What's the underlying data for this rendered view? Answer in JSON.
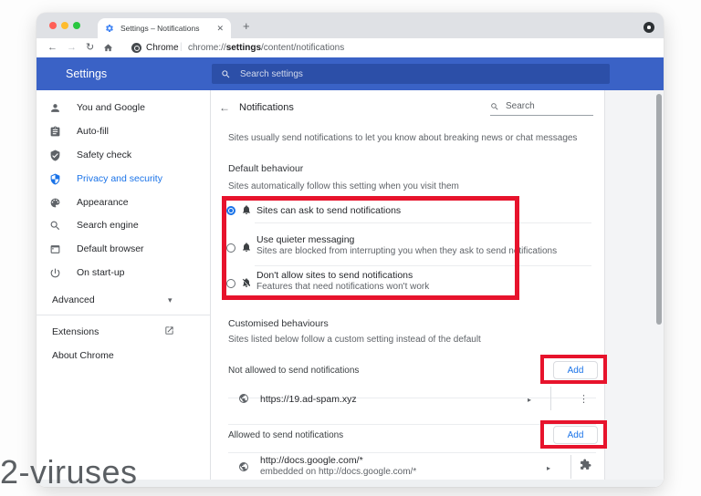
{
  "watermark": "2-viruses",
  "browser": {
    "tab_title": "Settings – Notifications",
    "url": {
      "origin_label": "Chrome",
      "prefix": "chrome://",
      "bold": "settings",
      "suffix": "/content/notifications"
    }
  },
  "header": {
    "title": "Settings",
    "search_placeholder": "Search settings"
  },
  "sidebar": {
    "items": [
      {
        "label": "You and Google",
        "icon": "person-icon"
      },
      {
        "label": "Auto-fill",
        "icon": "clipboard-icon"
      },
      {
        "label": "Safety check",
        "icon": "shield-check-icon"
      },
      {
        "label": "Privacy and security",
        "icon": "shield-half-icon",
        "active": true
      },
      {
        "label": "Appearance",
        "icon": "palette-icon"
      },
      {
        "label": "Search engine",
        "icon": "magnifier-icon"
      },
      {
        "label": "Default browser",
        "icon": "browser-window-icon"
      },
      {
        "label": "On start-up",
        "icon": "power-icon"
      }
    ],
    "advanced": "Advanced",
    "extensions": "Extensions",
    "about": "About Chrome"
  },
  "content": {
    "title": "Notifications",
    "search_placeholder": "Search",
    "intro": "Sites usually send notifications to let you know about breaking news or chat messages",
    "default_behaviour": {
      "heading": "Default behaviour",
      "subheading": "Sites automatically follow this setting when you visit them",
      "options": [
        {
          "label": "Sites can ask to send notifications",
          "selected": true
        },
        {
          "label": "Use quieter messaging",
          "description": "Sites are blocked from interrupting you when they ask to send notifications",
          "selected": false
        },
        {
          "label": "Don't allow sites to send notifications",
          "description": "Features that need notifications won't work",
          "selected": false
        }
      ]
    },
    "customised": {
      "heading": "Customised behaviours",
      "subheading": "Sites listed below follow a custom setting instead of the default",
      "not_allowed": {
        "label": "Not allowed to send notifications",
        "add_label": "Add",
        "sites": [
          {
            "url": "https://19.ad-spam.xyz"
          }
        ]
      },
      "allowed": {
        "label": "Allowed to send notifications",
        "add_label": "Add",
        "sites": [
          {
            "url": "http://docs.google.com/*",
            "embedded": "embedded on http://docs.google.com/*"
          }
        ]
      }
    }
  },
  "colors": {
    "accent_blue": "#1a73e8",
    "header_blue": "#3a62c6",
    "highlight_red": "#e7132c",
    "tabstrip_gray": "#dfe1e5"
  },
  "icons": {
    "back": "←",
    "forward": "→",
    "reload": "↻",
    "close": "✕",
    "plus": "+",
    "star": "☆",
    "more_vert": "⋮",
    "chevron_right": "▸",
    "caret_down": "▾",
    "pipe": "|"
  }
}
